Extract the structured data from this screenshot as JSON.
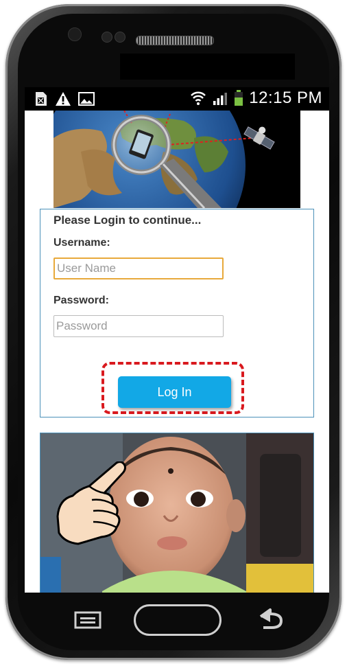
{
  "statusbar": {
    "time": "12:15 PM",
    "left_icons": [
      "sim-error-icon",
      "warning-icon",
      "image-icon"
    ],
    "right_icons": [
      "wifi-icon",
      "signal-icon",
      "battery-icon"
    ]
  },
  "login": {
    "title": "Please Login to continue...",
    "username_label": "Username:",
    "username_placeholder": "User Name",
    "password_label": "Password:",
    "password_placeholder": "Password",
    "button_label": "Log In"
  },
  "colors": {
    "button": "#12a8e6",
    "highlight_frame": "#d9191e",
    "focused_input_border": "#e8a93a",
    "box_border": "#4a90b8"
  },
  "nav": {
    "icons": [
      "menu-icon",
      "home-button",
      "back-icon"
    ]
  }
}
